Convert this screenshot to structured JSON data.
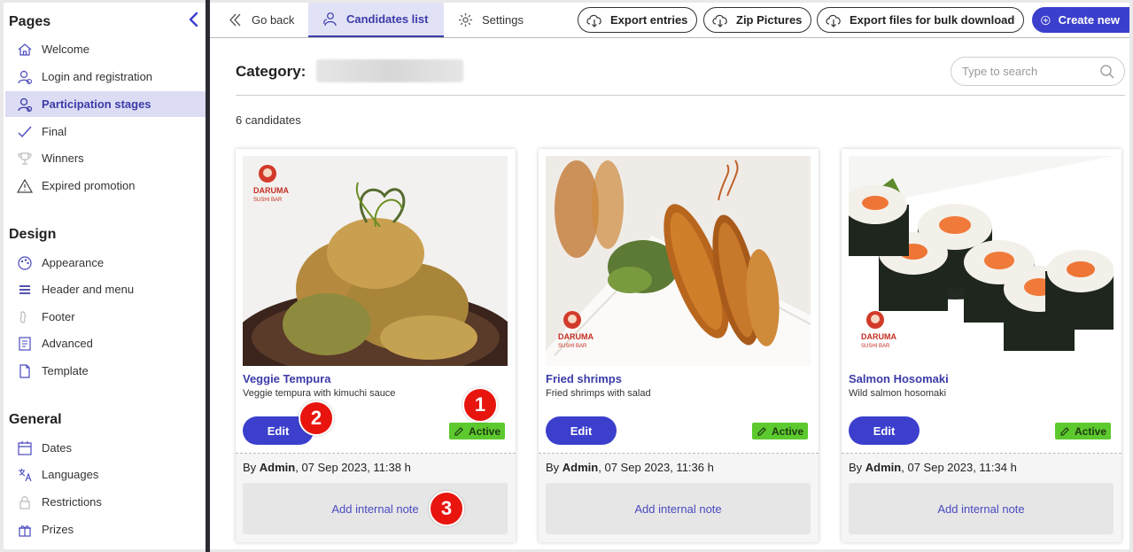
{
  "sidebar": {
    "collapse_label": "collapse",
    "sections": [
      {
        "title": "Pages",
        "items": [
          {
            "label": "Welcome",
            "icon": "home-icon"
          },
          {
            "label": "Login and registration",
            "icon": "user-icon"
          },
          {
            "label": "Participation stages",
            "icon": "user-gear-icon",
            "active": true
          },
          {
            "label": "Final",
            "icon": "check-icon"
          },
          {
            "label": "Winners",
            "icon": "trophy-icon"
          },
          {
            "label": "Expired promotion",
            "icon": "warning-icon"
          }
        ]
      },
      {
        "title": "Design",
        "items": [
          {
            "label": "Appearance",
            "icon": "palette-icon"
          },
          {
            "label": "Header and menu",
            "icon": "menu-icon"
          },
          {
            "label": "Footer",
            "icon": "footer-icon"
          },
          {
            "label": "Advanced",
            "icon": "advanced-icon"
          },
          {
            "label": "Template",
            "icon": "file-icon"
          }
        ]
      },
      {
        "title": "General",
        "items": [
          {
            "label": "Dates",
            "icon": "calendar-icon"
          },
          {
            "label": "Languages",
            "icon": "translate-icon"
          },
          {
            "label": "Restrictions",
            "icon": "lock-icon"
          },
          {
            "label": "Prizes",
            "icon": "gift-icon"
          }
        ]
      }
    ]
  },
  "topbar": {
    "go_back": "Go back",
    "candidates_tab": "Candidates list",
    "settings_tab": "Settings",
    "export_entries": "Export entries",
    "zip_pictures": "Zip Pictures",
    "export_bulk": "Export files for bulk download",
    "create_new": "Create new"
  },
  "main": {
    "category_label": "Category:",
    "search_placeholder": "Type to search",
    "count_text": "6 candidates",
    "cards": [
      {
        "title": "Veggie Tempura",
        "desc": "Veggie tempura with kimuchi sauce",
        "edit": "Edit",
        "status": "Active",
        "by": "By ",
        "author": "Admin",
        "date": ", 07 Sep 2023, 11:38 h",
        "note": "Add internal note",
        "photo": "veggie-tempura-photo"
      },
      {
        "title": "Fried shrimps",
        "desc": "Fried shrimps with salad",
        "edit": "Edit",
        "status": "Active",
        "by": "By ",
        "author": "Admin",
        "date": ", 07 Sep 2023, 11:36 h",
        "note": "Add internal note",
        "photo": "fried-shrimps-photo"
      },
      {
        "title": "Salmon Hosomaki",
        "desc": "Wild salmon hosomaki",
        "edit": "Edit",
        "status": "Active",
        "by": "By ",
        "author": "Admin",
        "date": ", 07 Sep 2023, 11:34 h",
        "note": "Add internal note",
        "photo": "salmon-hosomaki-photo"
      }
    ],
    "logo_text": [
      "DARUMA",
      "SUSHI BAR"
    ]
  },
  "callouts": [
    "1",
    "2",
    "3"
  ],
  "colors": {
    "accent": "#3b3fcc",
    "active_green": "#5cc92e",
    "callout_red": "#e8150f",
    "sidebar_active": "#dcdcf5"
  }
}
